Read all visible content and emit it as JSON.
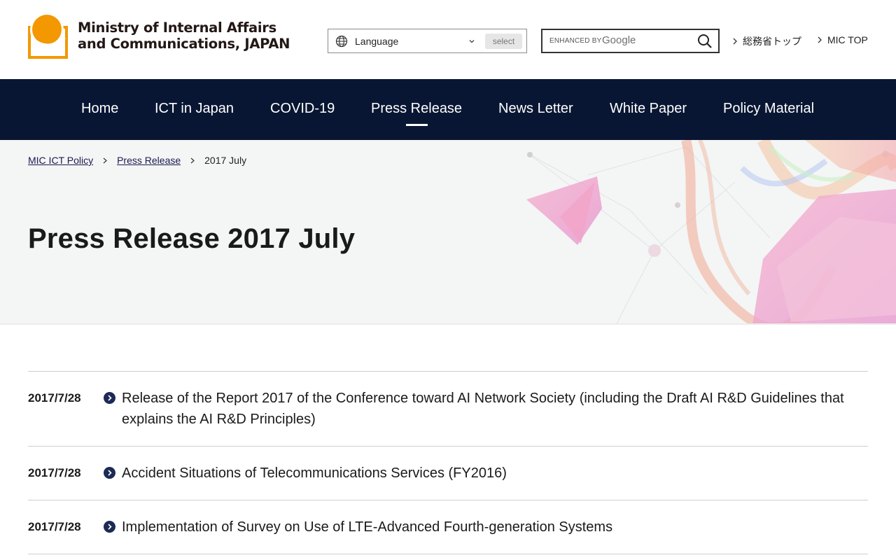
{
  "header": {
    "org_name_line1": "Ministry of Internal Affairs",
    "org_name_line2": "and Communications, JAPAN",
    "language_label": "Language",
    "language_button": "select",
    "search_enhanced": "ENHANCED BY",
    "search_google": "Google",
    "links": [
      "総務省トップ",
      "MIC TOP"
    ]
  },
  "nav": {
    "items": [
      "Home",
      "ICT in Japan",
      "COVID-19",
      "Press Release",
      "News Letter",
      "White Paper",
      "Policy Material"
    ],
    "active": "Press Release"
  },
  "breadcrumb": [
    "MIC ICT Policy",
    "Press Release",
    "2017 July"
  ],
  "page_title": "Press Release 2017 July",
  "releases": [
    {
      "date": "2017/7/28",
      "title": "Release of the Report 2017 of the Conference toward AI Network Society (including the Draft AI R&D Guidelines that explains the AI R&D Principles)"
    },
    {
      "date": "2017/7/28",
      "title": "Accident Situations of Telecommunications Services (FY2016)"
    },
    {
      "date": "2017/7/28",
      "title": "Implementation of Survey on Use of LTE-Advanced Fourth-generation Systems"
    }
  ],
  "colors": {
    "nav_bg": "#091633",
    "logo_orange": "#f39800",
    "list_arrow": "#1c2a55"
  },
  "icons": [
    "globe-icon",
    "chevron-down-icon",
    "search-icon",
    "chevron-right-icon",
    "circle-arrow-icon"
  ]
}
